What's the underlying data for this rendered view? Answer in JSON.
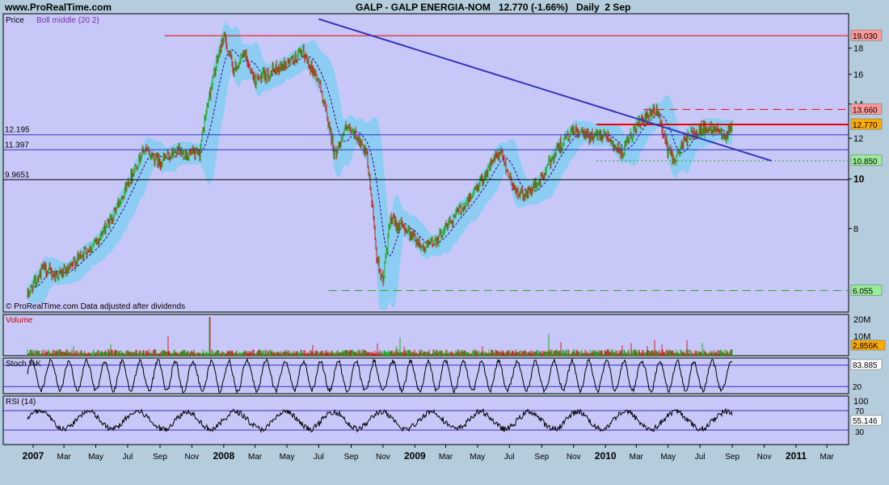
{
  "header": {
    "site": "www.ProRealTime.com",
    "title": "GALP - GALP ENERGIA-NOM   12.770 (-1.66%)   Daily  2 Sep"
  },
  "colors": {
    "panel_bg": "#c8c8f8",
    "frame_bg": "#b4ccdc",
    "band": "#8ecdf3",
    "candle_up": "#22aa22",
    "candle_down": "#cc2222",
    "trendline": "#3333bb",
    "resistance": "#ee0000",
    "support": "#22aa22"
  },
  "chart_data": [
    {
      "type": "candlestick",
      "panel": "price",
      "labels": [
        "Price",
        "Boll middle (20 2)"
      ],
      "footer": "© ProRealTime.com Data adjusted after dividends",
      "scale": "log",
      "ylim": [
        5.5,
        21
      ],
      "y_ticks": [
        8,
        10,
        12,
        14,
        16,
        18
      ],
      "x_tick_labels": [
        "2007",
        "Mar",
        "May",
        "Jul",
        "Sep",
        "Nov",
        "2008",
        "Mar",
        "May",
        "Jul",
        "Sep",
        "Nov",
        "2009",
        "Mar",
        "May",
        "Jul",
        "Sep",
        "Nov",
        "2010",
        "Mar",
        "May",
        "Jul",
        "Sep",
        "Nov",
        "2011",
        "Mar"
      ],
      "price_path": [
        [
          "2006-12-20",
          5.9
        ],
        [
          "2007-01-20",
          6.7
        ],
        [
          "2007-02-10",
          6.5
        ],
        [
          "2007-03-10",
          6.6
        ],
        [
          "2007-04-01",
          7.1
        ],
        [
          "2007-05-01",
          7.5
        ],
        [
          "2007-06-01",
          8.4
        ],
        [
          "2007-07-01",
          9.8
        ],
        [
          "2007-08-01",
          11.4
        ],
        [
          "2007-09-01",
          10.8
        ],
        [
          "2007-10-01",
          11.3
        ],
        [
          "2007-11-15",
          11.1
        ],
        [
          "2007-12-01",
          14.0
        ],
        [
          "2008-01-01",
          19.0
        ],
        [
          "2008-01-20",
          16.3
        ],
        [
          "2008-02-10",
          17.5
        ],
        [
          "2008-03-01",
          15.5
        ],
        [
          "2008-04-01",
          16.2
        ],
        [
          "2008-05-01",
          16.8
        ],
        [
          "2008-06-01",
          17.6
        ],
        [
          "2008-07-01",
          15.5
        ],
        [
          "2008-08-01",
          11.1
        ],
        [
          "2008-08-20",
          12.5
        ],
        [
          "2008-09-10",
          12.2
        ],
        [
          "2008-10-01",
          11.0
        ],
        [
          "2008-10-20",
          7.0
        ],
        [
          "2008-11-01",
          6.3
        ],
        [
          "2008-11-15",
          8.3
        ],
        [
          "2008-12-15",
          8.0
        ],
        [
          "2009-01-20",
          7.3
        ],
        [
          "2009-02-15",
          7.7
        ],
        [
          "2009-03-15",
          8.4
        ],
        [
          "2009-04-15",
          9.1
        ],
        [
          "2009-05-15",
          10.2
        ],
        [
          "2009-06-01",
          10.9
        ],
        [
          "2009-06-15",
          11.2
        ],
        [
          "2009-07-01",
          10.1
        ],
        [
          "2009-07-15",
          9.4
        ],
        [
          "2009-08-01",
          9.3
        ],
        [
          "2009-09-01",
          10.0
        ],
        [
          "2009-10-01",
          11.5
        ],
        [
          "2009-11-01",
          12.4
        ],
        [
          "2009-12-01",
          12.1
        ],
        [
          "2010-01-01",
          12.3
        ],
        [
          "2010-02-01",
          11.1
        ],
        [
          "2010-03-01",
          12.7
        ],
        [
          "2010-04-10",
          13.6
        ],
        [
          "2010-05-01",
          11.3
        ],
        [
          "2010-05-15",
          10.9
        ],
        [
          "2010-06-01",
          11.9
        ],
        [
          "2010-07-01",
          12.5
        ],
        [
          "2010-08-01",
          12.6
        ],
        [
          "2010-08-20",
          12.2
        ],
        [
          "2010-09-02",
          12.77
        ]
      ],
      "horizontal_lines": [
        {
          "label": "19.030",
          "value": 19.03,
          "from": "2007-09-10",
          "style": "solid",
          "color": "#ee0000"
        },
        {
          "label": "13.660",
          "value": 13.66,
          "from": "2010-03-15",
          "style": "dashed",
          "color": "#ee0000"
        },
        {
          "label": "12.770",
          "value": 12.77,
          "from": "2009-12-15",
          "style": "solid-thick",
          "color": "#ee0000"
        },
        {
          "label": "12.195",
          "value": 12.195,
          "style": "solid",
          "color": "#3333bb"
        },
        {
          "label": "11.397",
          "value": 11.397,
          "style": "solid",
          "color": "#3333bb"
        },
        {
          "label": "10.850",
          "value": 10.85,
          "from": "2009-12-15",
          "style": "dotted",
          "color": "#22aa22"
        },
        {
          "label": "9.9651",
          "value": 9.9651,
          "style": "solid",
          "color": "#000000"
        },
        {
          "label": "6.055",
          "value": 6.055,
          "from": "2008-07-20",
          "style": "dashed",
          "color": "#22aa22"
        }
      ],
      "trendline": {
        "from": [
          "2008-07-01",
          20.5
        ],
        "to": [
          "2010-11-15",
          10.85
        ]
      },
      "price_badges": [
        {
          "text": "19.030",
          "value": 19.03,
          "bg": "#ff9999"
        },
        {
          "text": "13.660",
          "value": 13.66,
          "bg": "#ff9999"
        },
        {
          "text": "12.770",
          "value": 12.77,
          "bg": "#ffaa00"
        },
        {
          "text": "10.850",
          "value": 10.85,
          "bg": "#99ee99"
        },
        {
          "text": "6.055",
          "value": 6.055,
          "bg": "#99ee99"
        }
      ]
    },
    {
      "type": "bar",
      "panel": "volume",
      "label": "Volume",
      "y_ticks": [
        "20M",
        "10M"
      ],
      "last_value": "2,856K"
    },
    {
      "type": "line",
      "panel": "stochastic",
      "label": "Stoch %K",
      "ylim": [
        0,
        100
      ],
      "levels": [
        80,
        20
      ],
      "last_value": "83.885",
      "tick_labels": [
        "20"
      ]
    },
    {
      "type": "line",
      "panel": "rsi",
      "label": "RSI (14)",
      "ylim": [
        0,
        100
      ],
      "levels": [
        70,
        30
      ],
      "last_value": "55.146",
      "tick_labels": [
        "100",
        "70",
        "30"
      ]
    }
  ]
}
